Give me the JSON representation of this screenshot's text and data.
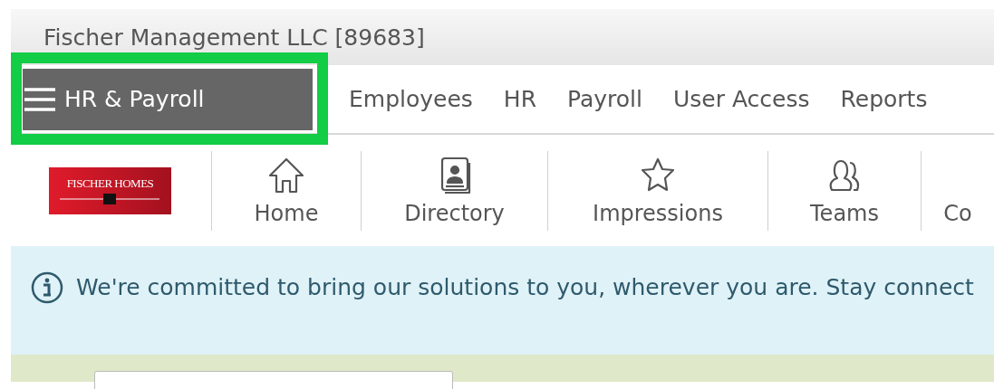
{
  "header": {
    "title": "Fischer Management LLC [89683]"
  },
  "menu_button": {
    "label": "HR & Payroll",
    "highlighted": true
  },
  "nav": [
    {
      "label": "Employees"
    },
    {
      "label": "HR"
    },
    {
      "label": "Payroll"
    },
    {
      "label": "User Access"
    },
    {
      "label": "Reports"
    }
  ],
  "logo": {
    "text": "FISCHER HOMES"
  },
  "toolbar": [
    {
      "label": "Home",
      "kind": "home"
    },
    {
      "label": "Directory",
      "kind": "directory"
    },
    {
      "label": "Impressions",
      "kind": "star"
    },
    {
      "label": "Teams",
      "kind": "people"
    },
    {
      "label": "Co",
      "kind": "plain"
    }
  ],
  "banner": {
    "text": "We're committed to bring our solutions to you, wherever you are. Stay connect"
  }
}
